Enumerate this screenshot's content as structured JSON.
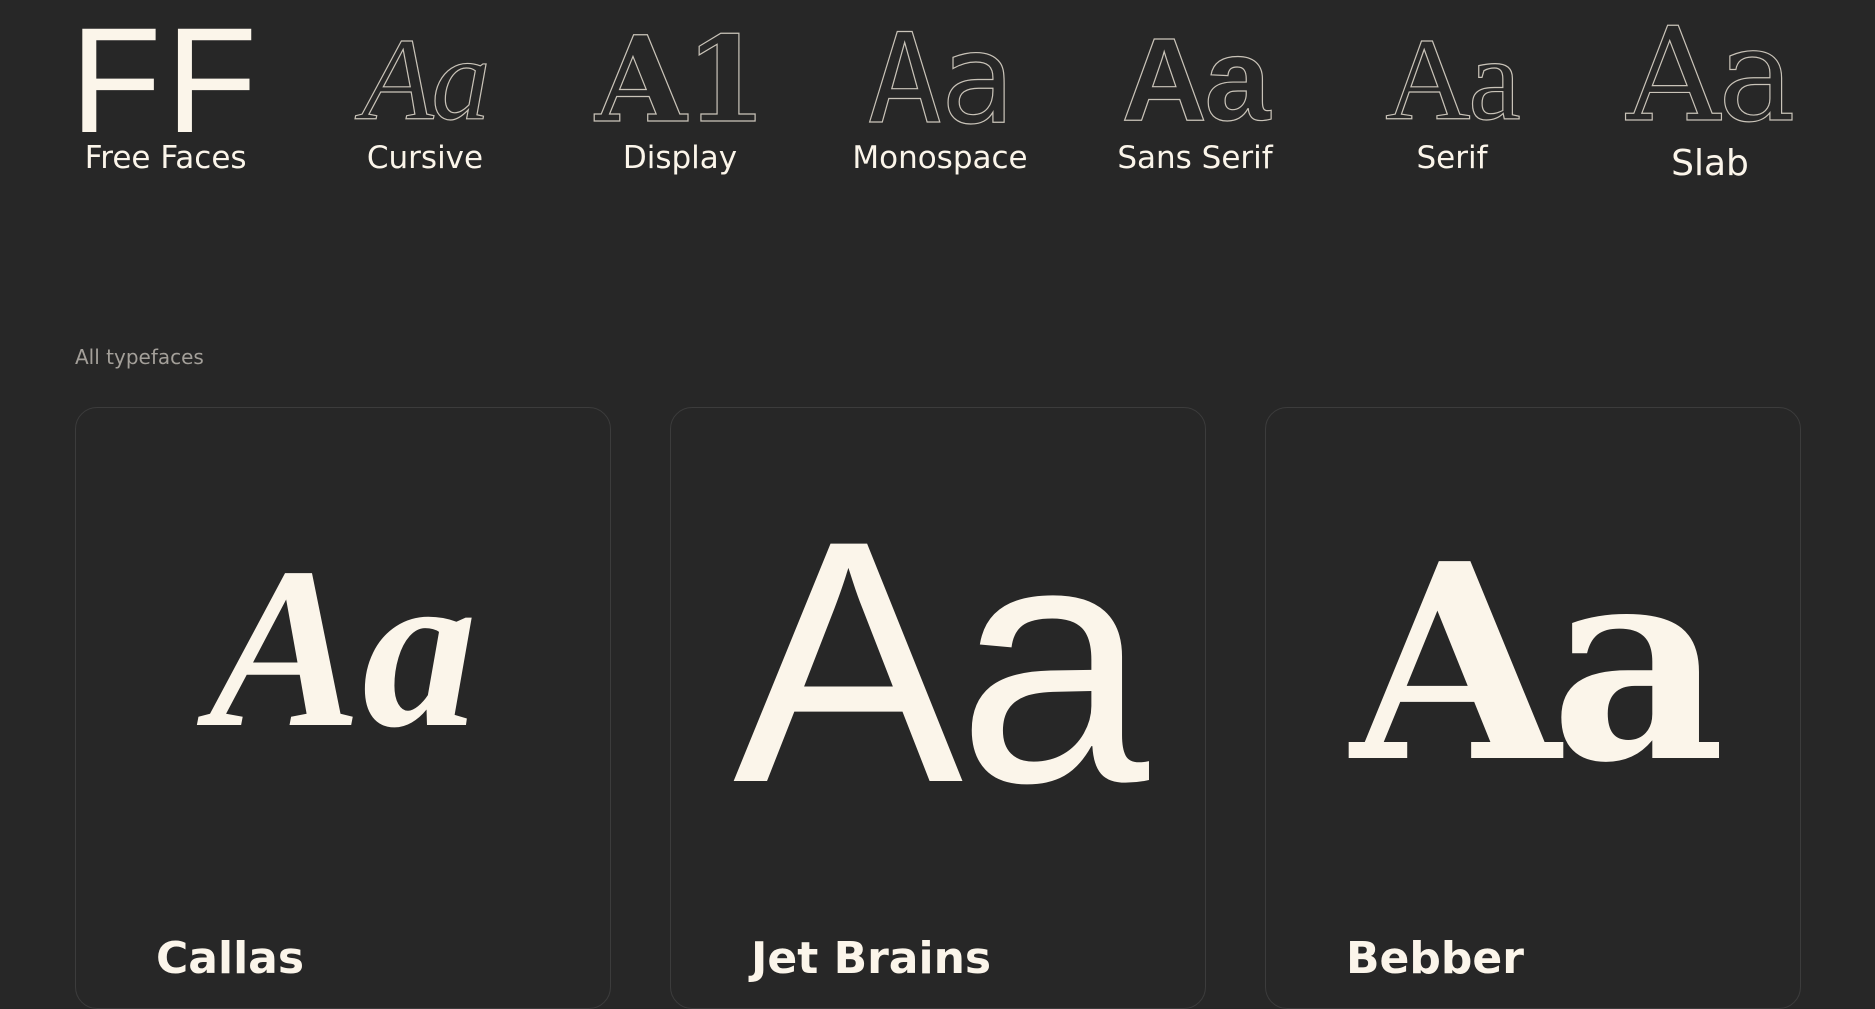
{
  "nav": {
    "logo": {
      "glyph": "FF",
      "label": "Free Faces"
    },
    "categories": [
      {
        "glyph": "Aa",
        "label": "Cursive"
      },
      {
        "glyph": "A1",
        "label": "Display"
      },
      {
        "glyph": "Aa",
        "label": "Monospace"
      },
      {
        "glyph": "Aa",
        "label": "Sans Serif"
      },
      {
        "glyph": "Aa",
        "label": "Serif"
      },
      {
        "glyph": "Aa",
        "label": "Slab"
      }
    ]
  },
  "section": {
    "label": "All typefaces"
  },
  "cards": [
    {
      "glyph": "Aa",
      "name": "Callas"
    },
    {
      "glyph": "Aa",
      "name": "Jet Brains"
    },
    {
      "glyph": "Aa",
      "name": "Bebber"
    }
  ],
  "colors": {
    "background": "#272727",
    "text": "#fbf5ea",
    "muted": "#a39f99",
    "outline": "#c9c3b8",
    "card_border": "#3c3c3c"
  }
}
